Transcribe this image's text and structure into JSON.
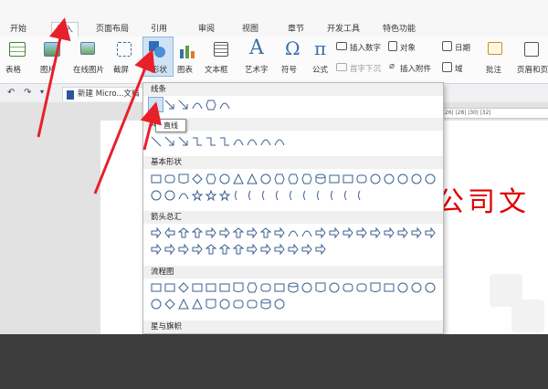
{
  "menu": {
    "tabs": [
      {
        "label": "开始"
      },
      {
        "label": "插入"
      },
      {
        "label": "页面布局"
      },
      {
        "label": "引用"
      },
      {
        "label": "审阅"
      },
      {
        "label": "视图"
      },
      {
        "label": "章节"
      },
      {
        "label": "开发工具"
      },
      {
        "label": "特色功能"
      }
    ]
  },
  "ribbon": {
    "table": "表格",
    "picture": "图片",
    "online_picture": "在线图片",
    "screenshot": "截屏",
    "shapes": "形状",
    "chart": "图表",
    "textbox": "文本框",
    "wordart": "艺术字",
    "symbol": "符号",
    "formula": "公式",
    "insert_number": "插入数字",
    "object": "对象",
    "date": "日期",
    "dropcap": "首字下沉",
    "insert_attachment": "插入附件",
    "field": "域",
    "comment": "批注",
    "header_footer": "页眉和页"
  },
  "document": {
    "tab_title": "新建 Micro...文档",
    "body_text": "公司文",
    "ruler_text": "|26|  |28|  |30|  |32|"
  },
  "shapes_panel": {
    "sections": [
      {
        "title": "线条"
      },
      {
        "title": "矩形"
      },
      {
        "title": "基本形状"
      },
      {
        "title": "箭头总汇"
      },
      {
        "title": "流程图"
      },
      {
        "title": "星与旗帜"
      }
    ],
    "tooltip": "直线"
  },
  "colors": {
    "accent": "#2b579a",
    "annotation": "#e8202a",
    "doc_text": "#e00000",
    "shape_stroke": "#3a5f8f"
  }
}
